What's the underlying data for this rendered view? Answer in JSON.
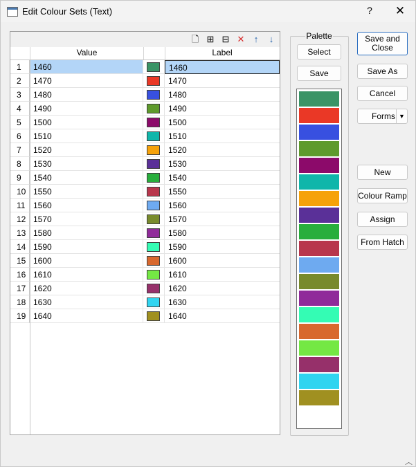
{
  "window": {
    "title": "Edit Colour Sets (Text)",
    "help_glyph": "?",
    "close_glyph": "✕",
    "app_icon": "window-icon"
  },
  "toolbar": {
    "new_icon": "new-document-icon",
    "insert_icon": "insert-row-icon",
    "append_icon": "append-row-icon",
    "delete_icon": "delete-icon",
    "up_icon": "move-up-icon",
    "down_icon": "move-down-icon",
    "new_glyph": "🗋",
    "insert_glyph": "⊞",
    "append_glyph": "⊟",
    "delete_glyph": "✕",
    "up_glyph": "↑",
    "down_glyph": "↓",
    "delete_color": "#d62a2a",
    "arrow_color": "#1f5ea8"
  },
  "grid": {
    "columns": [
      "Value",
      "Label"
    ],
    "selected_row": 1,
    "rows": [
      {
        "num": "1",
        "value": "1460",
        "color": "#3a9466",
        "label": "1460"
      },
      {
        "num": "2",
        "value": "1470",
        "color": "#ea3826",
        "label": "1470"
      },
      {
        "num": "3",
        "value": "1480",
        "color": "#3850e0",
        "label": "1480"
      },
      {
        "num": "4",
        "value": "1490",
        "color": "#5e9a2c",
        "label": "1490"
      },
      {
        "num": "5",
        "value": "1500",
        "color": "#8c0a6a",
        "label": "1500"
      },
      {
        "num": "6",
        "value": "1510",
        "color": "#10b6aa",
        "label": "1510"
      },
      {
        "num": "7",
        "value": "1520",
        "color": "#f6a20a",
        "label": "1520"
      },
      {
        "num": "8",
        "value": "1530",
        "color": "#5a3098",
        "label": "1530"
      },
      {
        "num": "9",
        "value": "1540",
        "color": "#28ae3c",
        "label": "1540"
      },
      {
        "num": "10",
        "value": "1550",
        "color": "#b8364c",
        "label": "1550"
      },
      {
        "num": "11",
        "value": "1560",
        "color": "#6eaaf0",
        "label": "1560"
      },
      {
        "num": "12",
        "value": "1570",
        "color": "#788a2c",
        "label": "1570"
      },
      {
        "num": "13",
        "value": "1580",
        "color": "#902a9a",
        "label": "1580"
      },
      {
        "num": "14",
        "value": "1590",
        "color": "#34fcb4",
        "label": "1590"
      },
      {
        "num": "15",
        "value": "1600",
        "color": "#d8682e",
        "label": "1600"
      },
      {
        "num": "16",
        "value": "1610",
        "color": "#74e844",
        "label": "1610"
      },
      {
        "num": "17",
        "value": "1620",
        "color": "#96306a",
        "label": "1620"
      },
      {
        "num": "18",
        "value": "1630",
        "color": "#30d4f0",
        "label": "1630"
      },
      {
        "num": "19",
        "value": "1640",
        "color": "#a09020",
        "label": "1640"
      }
    ]
  },
  "palette": {
    "title": "Palette",
    "select_label": "Select",
    "save_label": "Save"
  },
  "actions": {
    "save_close_line1": "Save and",
    "save_close_line2": "Close",
    "save_as_label": "Save As",
    "cancel_label": "Cancel",
    "forms_label": "Forms",
    "forms_caret": "▼",
    "new_label": "New",
    "colour_ramp_label": "Colour Ramp",
    "assign_label": "Assign",
    "from_hatch_label": "From Hatch"
  },
  "resize_grip": "︿"
}
